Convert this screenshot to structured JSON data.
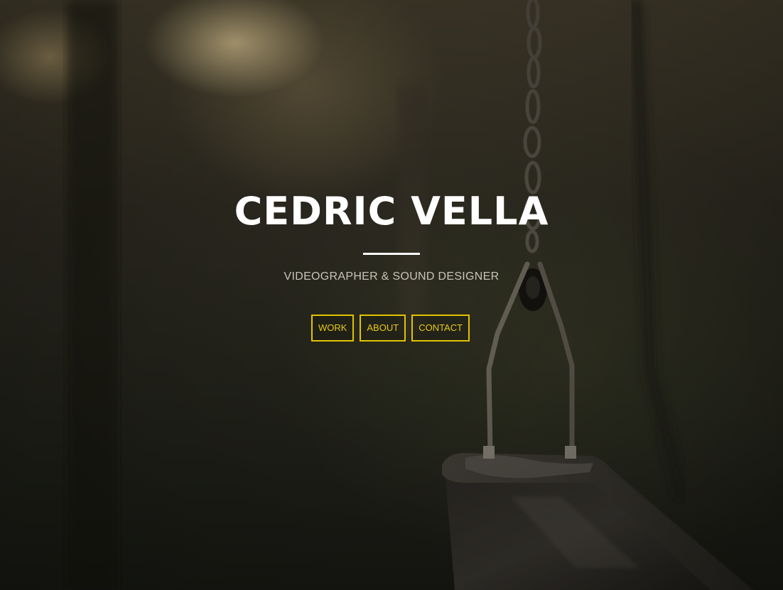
{
  "hero": {
    "title": "CEDRIC VELLA",
    "subtitle": "VIDEOGRAPHER & SOUND DESIGNER",
    "background_image": "swing-photo"
  },
  "nav": {
    "buttons": [
      {
        "label": "WORK"
      },
      {
        "label": "ABOUT"
      },
      {
        "label": "CONTACT"
      }
    ],
    "accent_color": "#e1c400"
  }
}
